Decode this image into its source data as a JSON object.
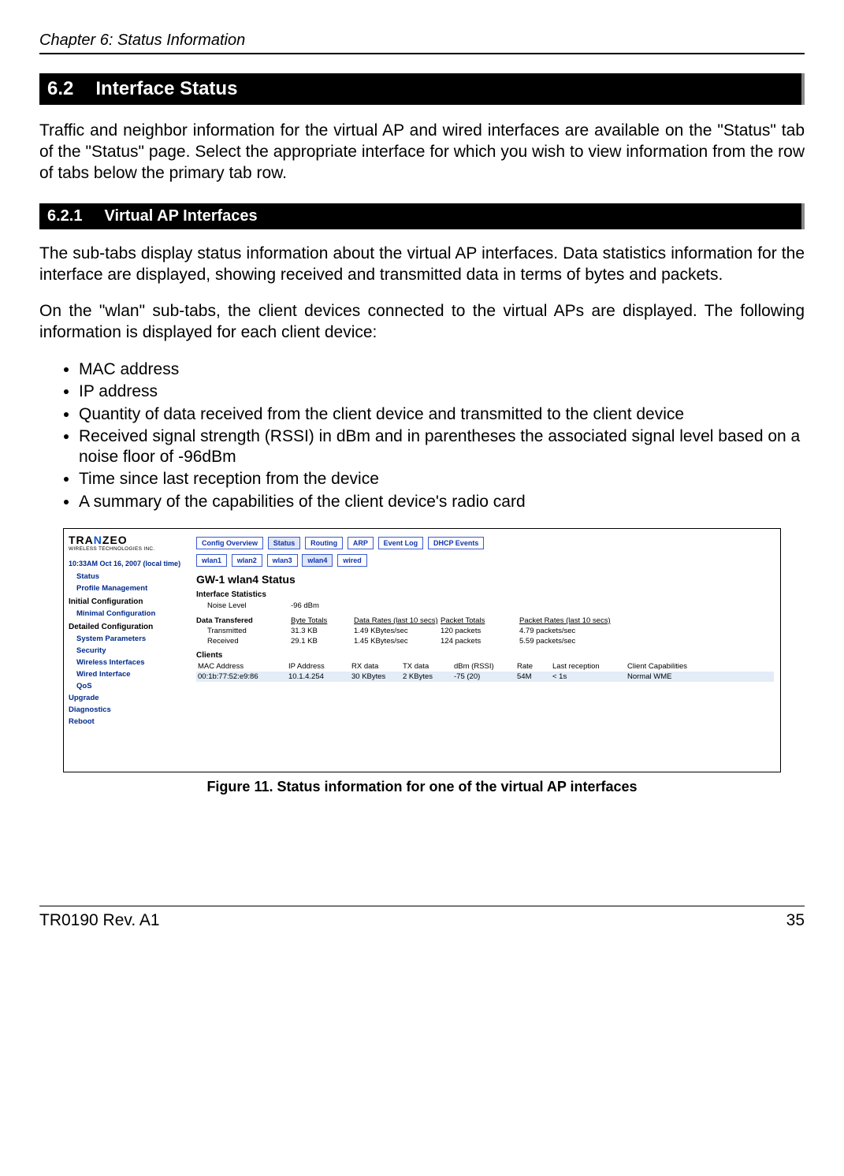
{
  "header": {
    "chapter": "Chapter 6: Status Information"
  },
  "section": {
    "num": "6.2",
    "title": "Interface Status"
  },
  "intro": "Traffic and neighbor information for the virtual AP and wired interfaces are available on the \"Status\" tab of the \"Status\" page. Select the appropriate interface for which you wish to view information from the row of tabs below the primary tab row.",
  "subsection": {
    "num": "6.2.1",
    "title": "Virtual AP Interfaces"
  },
  "para1": "The sub-tabs display status information about the virtual AP interfaces. Data statistics information for the interface are displayed, showing received and transmitted data in terms of bytes and packets.",
  "para2": "On the \"wlan\" sub-tabs, the client devices connected to the virtual APs are displayed. The following information is displayed for each client device:",
  "bullets": [
    "MAC address",
    "IP address",
    "Quantity of data received from the client device and transmitted to the client device",
    "Received signal strength (RSSI) in dBm and in parentheses the associated signal level based on a noise floor of -96dBm",
    "Time since last reception from the device",
    "A summary of the capabilities of the client device's radio card"
  ],
  "screenshot": {
    "logo": {
      "brand_pre": "TRA",
      "brand_mid": "N",
      "brand_post": "ZEO",
      "subtitle": "WIRELESS TECHNOLOGIES INC."
    },
    "time": "10:33AM Oct 16, 2007 (local time)",
    "sidebar": {
      "links1": [
        "Status",
        "Profile Management"
      ],
      "heading1": "Initial Configuration",
      "links2": [
        "Minimal Configuration"
      ],
      "heading2": "Detailed Configuration",
      "links3": [
        "System Parameters",
        "Security",
        "Wireless Interfaces",
        "Wired Interface",
        "QoS"
      ],
      "links4": [
        "Upgrade",
        "Diagnostics",
        "Reboot"
      ]
    },
    "tabs_main": [
      "Config Overview",
      "Status",
      "Routing",
      "ARP",
      "Event Log",
      "DHCP Events"
    ],
    "tabs_main_active": "Status",
    "tabs_sub": [
      "wlan1",
      "wlan2",
      "wlan3",
      "wlan4",
      "wired"
    ],
    "tabs_sub_active": "wlan4",
    "page_title": "GW-1 wlan4 Status",
    "stats": {
      "hdr": "Interface Statistics",
      "noise_lbl": "Noise Level",
      "noise_val": "-96 dBm",
      "dt_lbl": "Data Transfered",
      "col_byte": "Byte Totals",
      "col_drate": "Data Rates (last 10 secs)",
      "col_ptot": "Packet Totals",
      "col_prate": "Packet Rates (last 10 secs)",
      "tx_lbl": "Transmitted",
      "tx_bytes": "31.3 KB",
      "tx_drate": "1.49 KBytes/sec",
      "tx_ptot": "120 packets",
      "tx_prate": "4.79 packets/sec",
      "rx_lbl": "Received",
      "rx_bytes": "29.1 KB",
      "rx_drate": "1.45 KBytes/sec",
      "rx_ptot": "124 packets",
      "rx_prate": "5.59 packets/sec"
    },
    "clients": {
      "hdr": "Clients",
      "cols": {
        "mac": "MAC Address",
        "ip": "IP Address",
        "rx": "RX data",
        "tx": "TX data",
        "dbm": "dBm (RSSI)",
        "rate": "Rate",
        "last": "Last reception",
        "cap": "Client Capabilities"
      },
      "row": {
        "mac": "00:1b:77:52:e9:86",
        "ip": "10.1.4.254",
        "rx": "30 KBytes",
        "tx": "2 KBytes",
        "dbm": "-75 (20)",
        "rate": "54M",
        "last": "< 1s",
        "cap": "Normal WME"
      }
    }
  },
  "figure_caption": "Figure 11. Status information for one of the virtual AP interfaces",
  "footer": {
    "left": "TR0190 Rev. A1",
    "right": "35"
  }
}
